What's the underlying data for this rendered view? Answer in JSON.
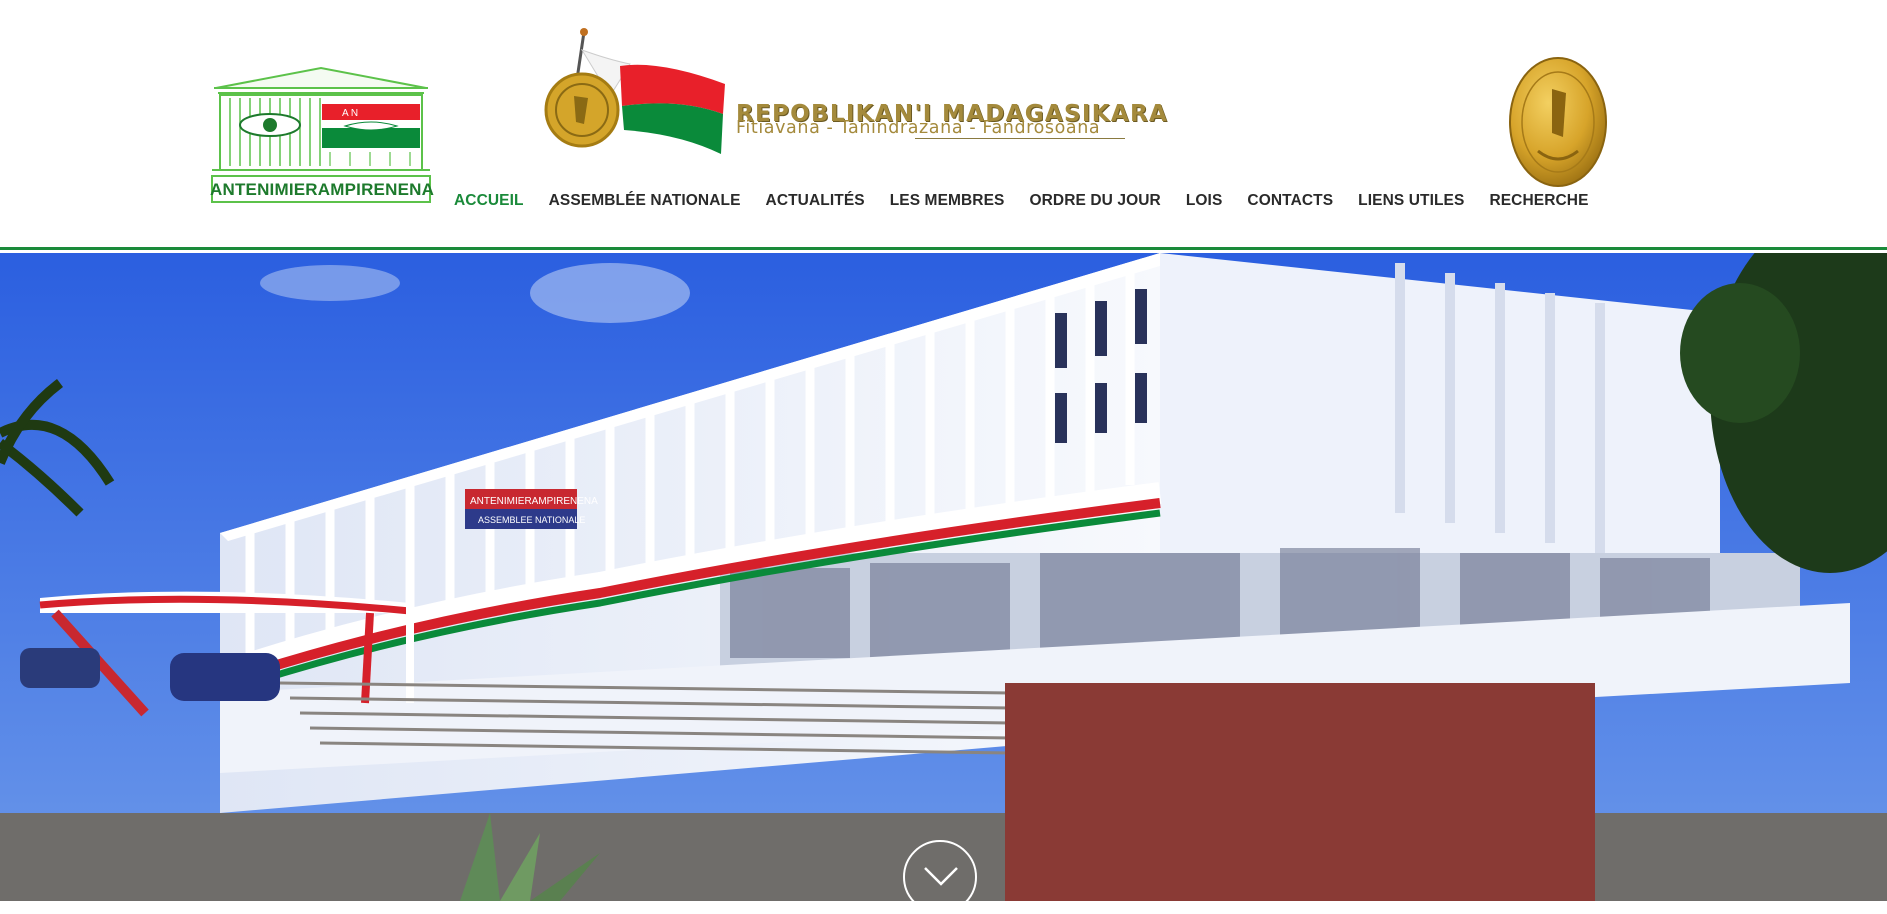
{
  "header": {
    "left_logo": {
      "name": "antenimierampirenena-logo",
      "text": "ANTENIMIERAMPIRENENA",
      "badge_letters": "A  N"
    },
    "republic": {
      "title": "REPOBLIKAN'I MADAGASIKARA",
      "motto": "Fitiavana - Tanindrazana - Fandrosoana"
    },
    "seal": {
      "name": "republic-seal-icon"
    }
  },
  "nav": {
    "items": [
      {
        "label": "ACCUEIL",
        "active": true
      },
      {
        "label": "ASSEMBLÉE NATIONALE",
        "active": false
      },
      {
        "label": "ACTUALITÉS",
        "active": false
      },
      {
        "label": "LES MEMBRES",
        "active": false
      },
      {
        "label": "ORDRE DU JOUR",
        "active": false
      },
      {
        "label": "LOIS",
        "active": false
      },
      {
        "label": "CONTACTS",
        "active": false
      },
      {
        "label": "LIENS UTILES",
        "active": false
      },
      {
        "label": "RECHERCHE",
        "active": false
      }
    ]
  },
  "hero": {
    "sign_line1": "ANTENIMIERAMPIRENENA",
    "sign_line2": "ASSEMBLEE NATIONALE",
    "scroll_icon": "chevron-down-icon"
  },
  "colors": {
    "accent_green": "#1a8a3a",
    "gold": "#a48a3c",
    "flag_red": "#e8202a",
    "flag_green": "#0a8a3a"
  }
}
